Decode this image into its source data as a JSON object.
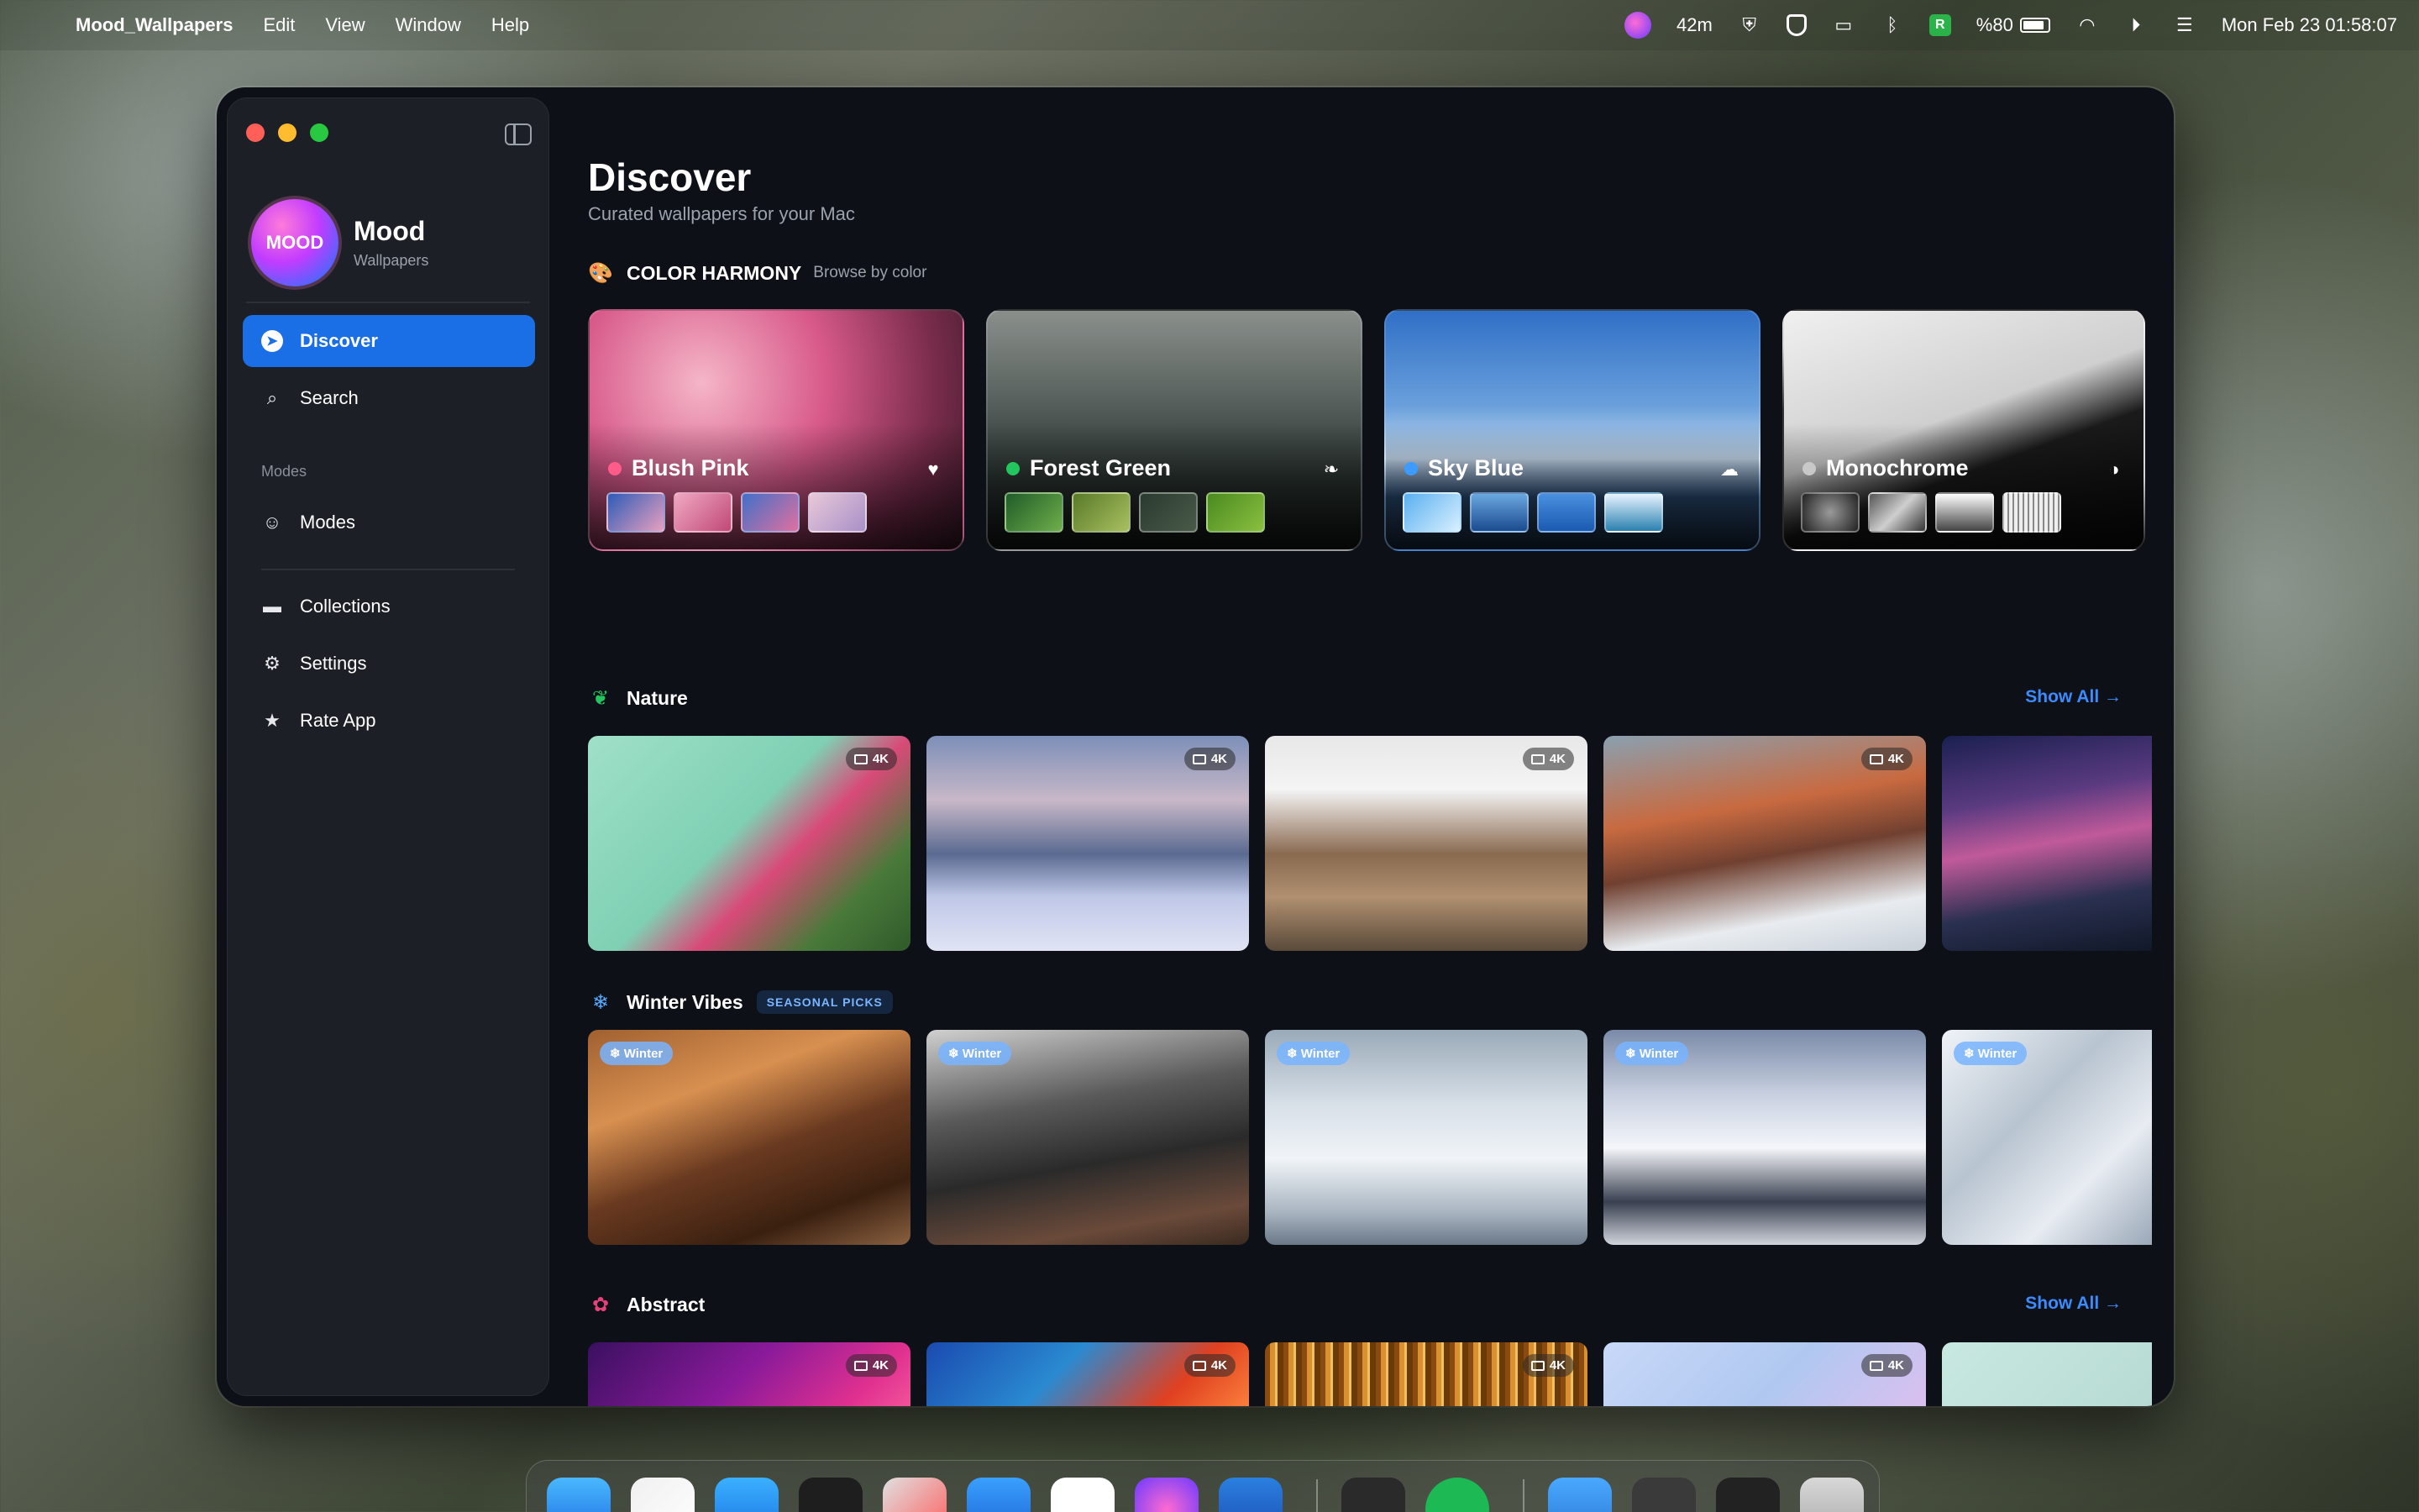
{
  "menubar": {
    "app_name": "Mood_Wallpapers",
    "menus": [
      "Edit",
      "View",
      "Window",
      "Help"
    ],
    "status": {
      "timer": "42m",
      "battery": "%80",
      "datetime": "Mon Feb 23  01:58:07"
    }
  },
  "sidebar": {
    "brand_name": "Mood",
    "brand_sub": "Wallpapers",
    "logo_text": "MOOD",
    "nav": {
      "discover": "Discover",
      "search": "Search",
      "modes_section": "Modes",
      "modes": "Modes",
      "collections": "Collections",
      "settings": "Settings",
      "rate": "Rate App"
    }
  },
  "main": {
    "title": "Discover",
    "subtitle": "Curated wallpapers for your Mac",
    "color_harmony": {
      "title": "COLOR HARMONY",
      "subtitle": "Browse by color",
      "cards": [
        {
          "name": "Blush Pink",
          "dot": "#ff5c8a",
          "icon": "heart-icon"
        },
        {
          "name": "Forest Green",
          "dot": "#22c55e",
          "icon": "leaf-icon"
        },
        {
          "name": "Sky Blue",
          "dot": "#3b9bff",
          "icon": "cloud-icon"
        },
        {
          "name": "Monochrome",
          "dot": "#c8c8c8",
          "icon": "contrast-icon"
        }
      ]
    },
    "nature": {
      "title": "Nature",
      "show_all": "Show All →",
      "badge": "4K"
    },
    "winter": {
      "title": "Winter Vibes",
      "badge": "SEASONAL PICKS",
      "tag": "❄ Winter"
    },
    "abstract": {
      "title": "Abstract",
      "show_all": "Show All →",
      "badge": "4K"
    }
  },
  "colors": {
    "accent": "#1b6fe6",
    "link": "#3b8bff",
    "window_bg": "#0d1117",
    "sidebar_bg": "#1c1f25"
  }
}
